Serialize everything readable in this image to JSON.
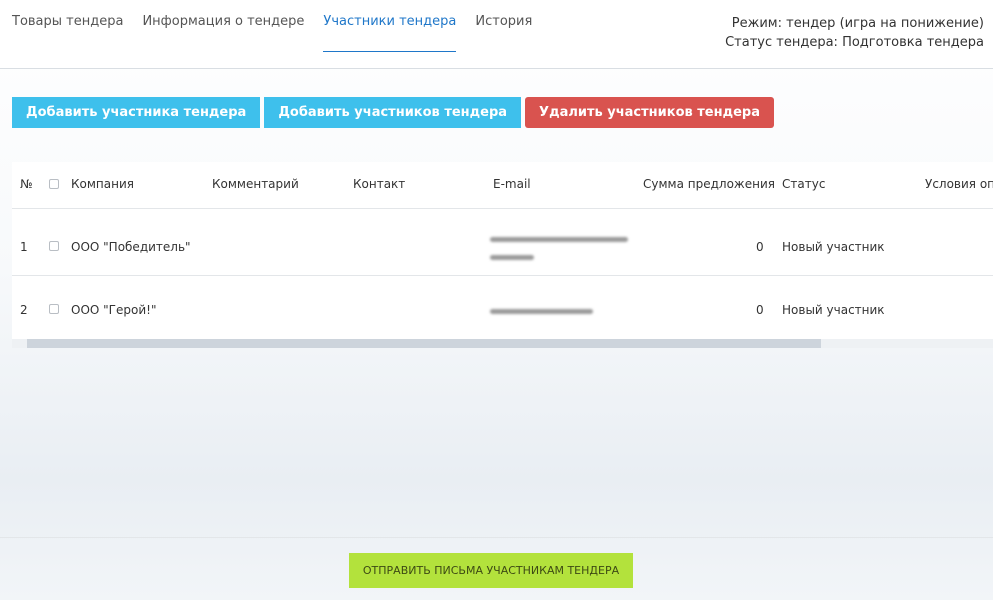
{
  "tabs": [
    {
      "label": "Товары тендера"
    },
    {
      "label": "Информация о тендере"
    },
    {
      "label": "Участники тендера"
    },
    {
      "label": "История"
    }
  ],
  "status": {
    "mode_label": "Режим:",
    "mode_value": "тендер (игра на понижение)",
    "status_label": "Статус тендера:",
    "status_value": "Подготовка тендера"
  },
  "toolbar": {
    "add_one": "Добавить участника тендера",
    "add_many": "Добавить участников тендера",
    "delete": "Удалить участников тендера"
  },
  "table": {
    "columns": {
      "num": "№",
      "company": "Компания",
      "comment": "Комментарий",
      "contact": "Контакт",
      "email": "E-mail",
      "sum": "Сумма предложения",
      "status": "Статус",
      "conditions": "Условия оп"
    },
    "rows": [
      {
        "num": "1",
        "company": "ООО \"Победитель\"",
        "comment": "",
        "contact": "",
        "sum": "0",
        "status": "Новый участник"
      },
      {
        "num": "2",
        "company": "ООО \"Герой!\"",
        "comment": "",
        "contact": "",
        "sum": "0",
        "status": "Новый участник"
      }
    ]
  },
  "footer": {
    "send_label": "Отправить письма участникам тендера"
  },
  "colors": {
    "accent": "#1f77c9",
    "add_button": "#3ec0ec",
    "delete_button": "#d9534f",
    "send_button": "#b3e23c"
  }
}
